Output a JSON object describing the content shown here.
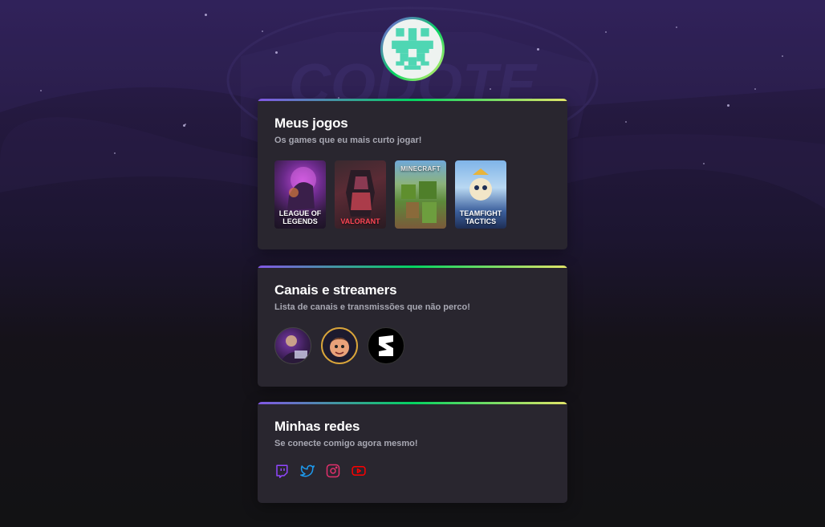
{
  "profile": {
    "avatar_icon": "pixel-avatar-icon",
    "avatar_colors": [
      "#4fd6b3",
      "#eef3f0"
    ]
  },
  "games_card": {
    "title": "Meus jogos",
    "subtitle": "Os games que eu mais curto jogar!",
    "games": [
      {
        "label": "LEAGUE OF LEGENDS"
      },
      {
        "label": "VALORANT"
      },
      {
        "label": "MINECRAFT"
      },
      {
        "label": "TEAMFIGHT TACTICS"
      }
    ]
  },
  "streamers_card": {
    "title": "Canais e streamers",
    "subtitle": "Lista de canais e transmissões que não perco!"
  },
  "social_card": {
    "title": "Minhas redes",
    "subtitle": "Se conecte comigo agora mesmo!",
    "links": [
      {
        "icon": "twitch-icon",
        "color": "#9146ff"
      },
      {
        "icon": "twitter-icon",
        "color": "#1d9bf0"
      },
      {
        "icon": "instagram-icon",
        "color": "#e1306c"
      },
      {
        "icon": "youtube-icon",
        "color": "#ff0000"
      }
    ]
  },
  "theme": {
    "background": "#121214",
    "card": "#29262f",
    "accent_gradient": [
      "#8257e5",
      "#04d361",
      "#e1e468"
    ]
  }
}
